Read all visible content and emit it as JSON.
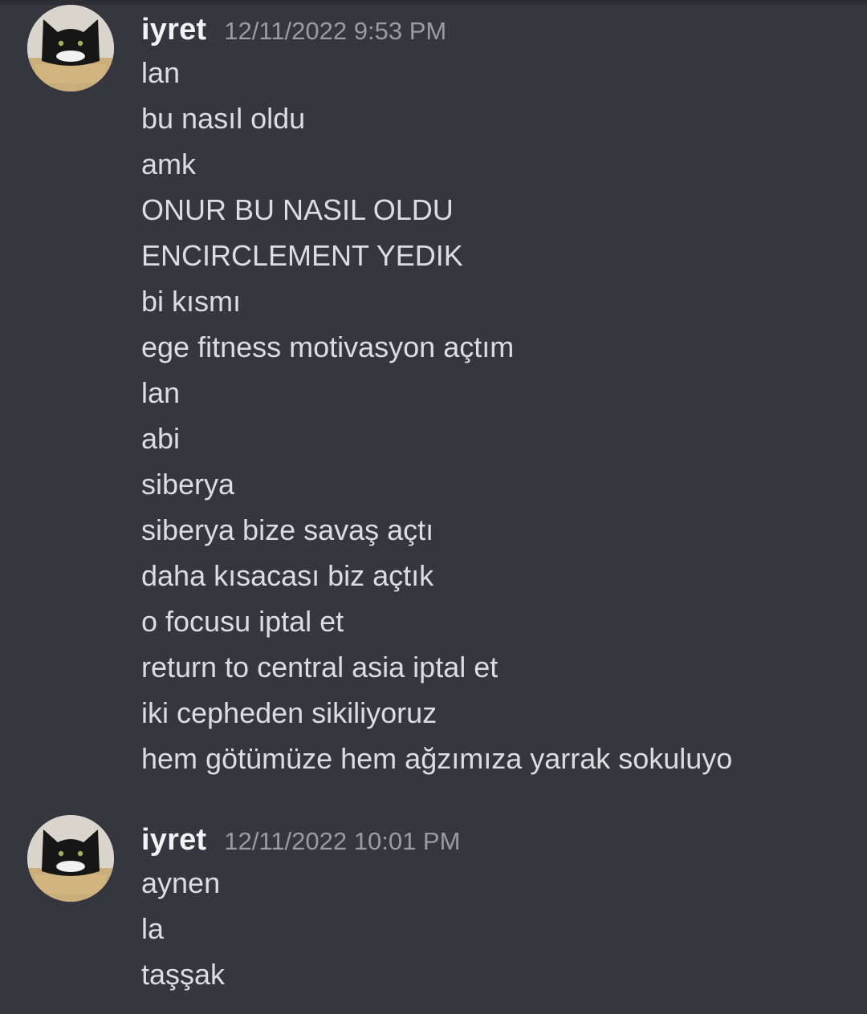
{
  "messages": [
    {
      "username": "iyret",
      "timestamp": "12/11/2022 9:53 PM",
      "lines": [
        "lan",
        "bu nasıl oldu",
        "amk",
        "ONUR BU NASIL OLDU",
        "ENCIRCLEMENT YEDIK",
        "bi kısmı",
        "ege fitness motivasyon açtım",
        "lan",
        "abi",
        "siberya",
        "siberya bize savaş açtı",
        "daha kısacası biz açtık",
        "o focusu iptal et",
        "return to central asia iptal et",
        "iki cepheden sikiliyoruz",
        "hem götümüze hem ağzımıza yarrak sokuluyo"
      ]
    },
    {
      "username": "iyret",
      "timestamp": "12/11/2022 10:01 PM",
      "lines": [
        "aynen",
        "la",
        "taşşak"
      ]
    }
  ],
  "icons": {
    "avatar": "black-cat-avatar"
  },
  "colors": {
    "background": "#36373e",
    "username": "#f2f3f5",
    "timestamp": "#9a9ca3",
    "text": "#dbdee1"
  }
}
